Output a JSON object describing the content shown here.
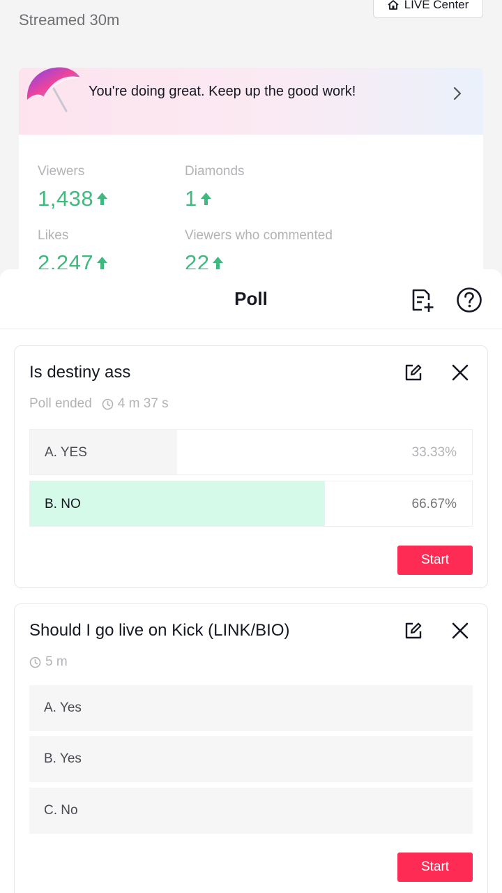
{
  "summary": {
    "streamed_label": "Streamed  30m",
    "live_center_label": "LIVE Center",
    "banner_message": "You're doing great. Keep up the good work!",
    "stats": {
      "viewers": {
        "label": "Viewers",
        "value": "1,438"
      },
      "diamonds": {
        "label": "Diamonds",
        "value": "1"
      },
      "likes": {
        "label": "Likes",
        "value": "2,247"
      },
      "viewers_commented": {
        "label": "Viewers who commented",
        "value": "22"
      }
    }
  },
  "sheet": {
    "title": "Poll"
  },
  "polls": [
    {
      "question": "Is destiny ass",
      "status": "Poll ended",
      "duration": "4 m 37 s",
      "options": [
        {
          "label": "A. YES",
          "percent_text": "33.33%",
          "share": 0.3333,
          "winner": false
        },
        {
          "label": "B. NO",
          "percent_text": "66.67%",
          "share": 0.6667,
          "winner": true
        }
      ],
      "start_label": "Start"
    },
    {
      "question": "Should I go live on Kick (LINK/BIO)",
      "duration": "5 m",
      "options": [
        {
          "label": "A. Yes"
        },
        {
          "label": "B. Yes"
        },
        {
          "label": "C. No"
        }
      ],
      "start_label": "Start"
    }
  ],
  "colors": {
    "accent_red": "#fe2c55",
    "stat_green": "#3fb97d",
    "winner_fill": "#d6fae9",
    "loser_fill": "#f5f5f6"
  },
  "icons": {
    "live_center": "house-icon",
    "banner": "umbrella-icon",
    "banner_arrow": "chevron-right-icon",
    "stat_trend": "arrow-up-icon",
    "add_poll": "add-list-icon",
    "help": "help-icon",
    "edit": "edit-icon",
    "close": "close-icon",
    "timer": "clock-icon"
  }
}
